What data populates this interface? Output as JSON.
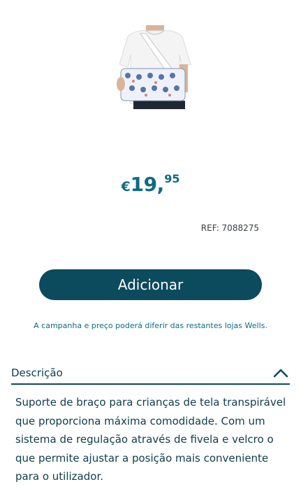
{
  "product": {
    "image_alt": "Suporte de braço infantil",
    "price": {
      "currency": "€",
      "integer": "19",
      "separator": ",",
      "cents": "95"
    },
    "ref": "REF: 7088275"
  },
  "actions": {
    "add_label": "Adicionar"
  },
  "disclaimer": "A campanha e preço poderá diferir das restantes lojas Wells.",
  "description": {
    "title": "Descrição",
    "text": "Suporte de braço para crianças de tela transpirável que proporciona máxima comodidade. Com um sistema de regulação através de fivela e velcro o que permite ajustar a posição mais conveniente para o utilizador."
  },
  "colors": {
    "primary": "#0c4a5d",
    "price": "#0e6a83",
    "text": "#0c3d4c"
  }
}
